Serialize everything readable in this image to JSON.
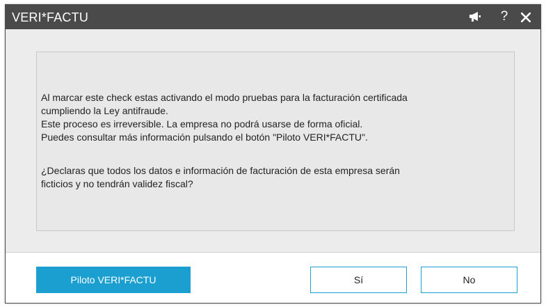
{
  "window": {
    "title": "VERI*FACTU",
    "help_label": "?",
    "colors": {
      "titlebar": "#4a4a4a",
      "accent": "#1a9fd0",
      "content_bg": "#ececec",
      "footer_bg": "#ffffff"
    },
    "icons": [
      "megaphone-icon",
      "help-icon",
      "close-icon"
    ]
  },
  "message": {
    "paragraph1": [
      "Al marcar este check estas activando el modo pruebas para la facturación certificada",
      "cumpliendo la Ley antifraude.",
      "Este proceso es irreversible. La empresa no podrá usarse de forma oficial.",
      "Puedes consultar más información pulsando el botón \"Piloto VERI*FACTU\"."
    ],
    "paragraph2": [
      "¿Declaras que todos los datos e información de facturación de esta empresa serán",
      "ficticios y no tendrán validez fiscal?"
    ]
  },
  "buttons": {
    "piloto": "Piloto VERI*FACTU",
    "si": "Sí",
    "no": "No"
  }
}
